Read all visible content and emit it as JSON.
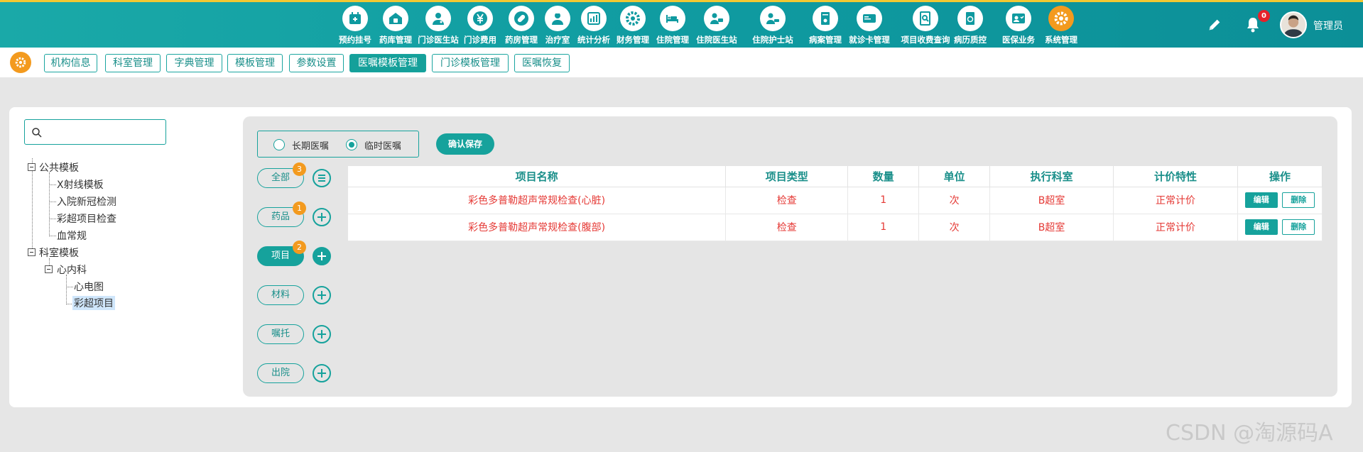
{
  "topnav": {
    "items": [
      {
        "label": "预约挂号",
        "icon": "register-icon"
      },
      {
        "label": "药库管理",
        "icon": "pharmacy-storage-icon"
      },
      {
        "label": "门诊医生站",
        "icon": "doctor-icon"
      },
      {
        "label": "门诊费用",
        "icon": "yuan-icon"
      },
      {
        "label": "药房管理",
        "icon": "pill-icon"
      },
      {
        "label": "治疗室",
        "icon": "nurse-icon"
      },
      {
        "label": "统计分析",
        "icon": "chart-icon"
      },
      {
        "label": "财务管理",
        "icon": "finance-gear-icon"
      },
      {
        "label": "住院管理",
        "icon": "bed-icon"
      },
      {
        "label": "住院医生站",
        "icon": "inpatient-doctor-icon"
      },
      {
        "label": "住院护士站",
        "icon": "inpatient-nurse-icon"
      },
      {
        "label": "病案管理",
        "icon": "record-icon"
      },
      {
        "label": "就诊卡管理",
        "icon": "card-icon"
      },
      {
        "label": "项目收费查询",
        "icon": "search-doc-icon"
      },
      {
        "label": "病历质控",
        "icon": "quality-icon"
      },
      {
        "label": "医保业务",
        "icon": "insurance-icon"
      },
      {
        "label": "系统管理",
        "icon": "system-gear-icon"
      }
    ],
    "notification_count": "0",
    "username": "管理员"
  },
  "subtabs": [
    "机构信息",
    "科室管理",
    "字典管理",
    "模板管理",
    "参数设置",
    "医嘱模板管理",
    "门诊模板管理",
    "医嘱恢复"
  ],
  "active_subtab": "医嘱模板管理",
  "search": {
    "value": "",
    "placeholder": ""
  },
  "tree": {
    "public": "公共模板",
    "public_items": [
      "X射线模板",
      "入院新冠检测",
      "彩超项目检查",
      "血常规"
    ],
    "dept": "科室模板",
    "dept_child": "心内科",
    "dept_child_items": [
      "心电图",
      "彩超项目"
    ],
    "selected": "彩超项目"
  },
  "order_type": {
    "long": "长期医嘱",
    "temp": "临时医嘱",
    "selected": "临时医嘱"
  },
  "save_label": "确认保存",
  "categories": [
    {
      "label": "全部",
      "badge": "3"
    },
    {
      "label": "药品",
      "badge": "1"
    },
    {
      "label": "项目",
      "badge": "2"
    },
    {
      "label": "材料",
      "badge": ""
    },
    {
      "label": "嘱托",
      "badge": ""
    },
    {
      "label": "出院",
      "badge": ""
    }
  ],
  "table": {
    "headers": [
      "项目名称",
      "项目类型",
      "数量",
      "单位",
      "执行科室",
      "计价特性",
      "操作"
    ],
    "rows": [
      [
        "彩色多普勒超声常规检查(心脏)",
        "检查",
        "1",
        "次",
        "B超室",
        "正常计价"
      ],
      [
        "彩色多普勒超声常规检查(腹部)",
        "检查",
        "1",
        "次",
        "B超室",
        "正常计价"
      ]
    ],
    "edit_label": "编辑",
    "delete_label": "删除"
  },
  "watermark": "CSDN @淘源码A",
  "colors": {
    "primary": "#16a29c",
    "accent": "#f39a1e",
    "alert": "#e53935"
  }
}
